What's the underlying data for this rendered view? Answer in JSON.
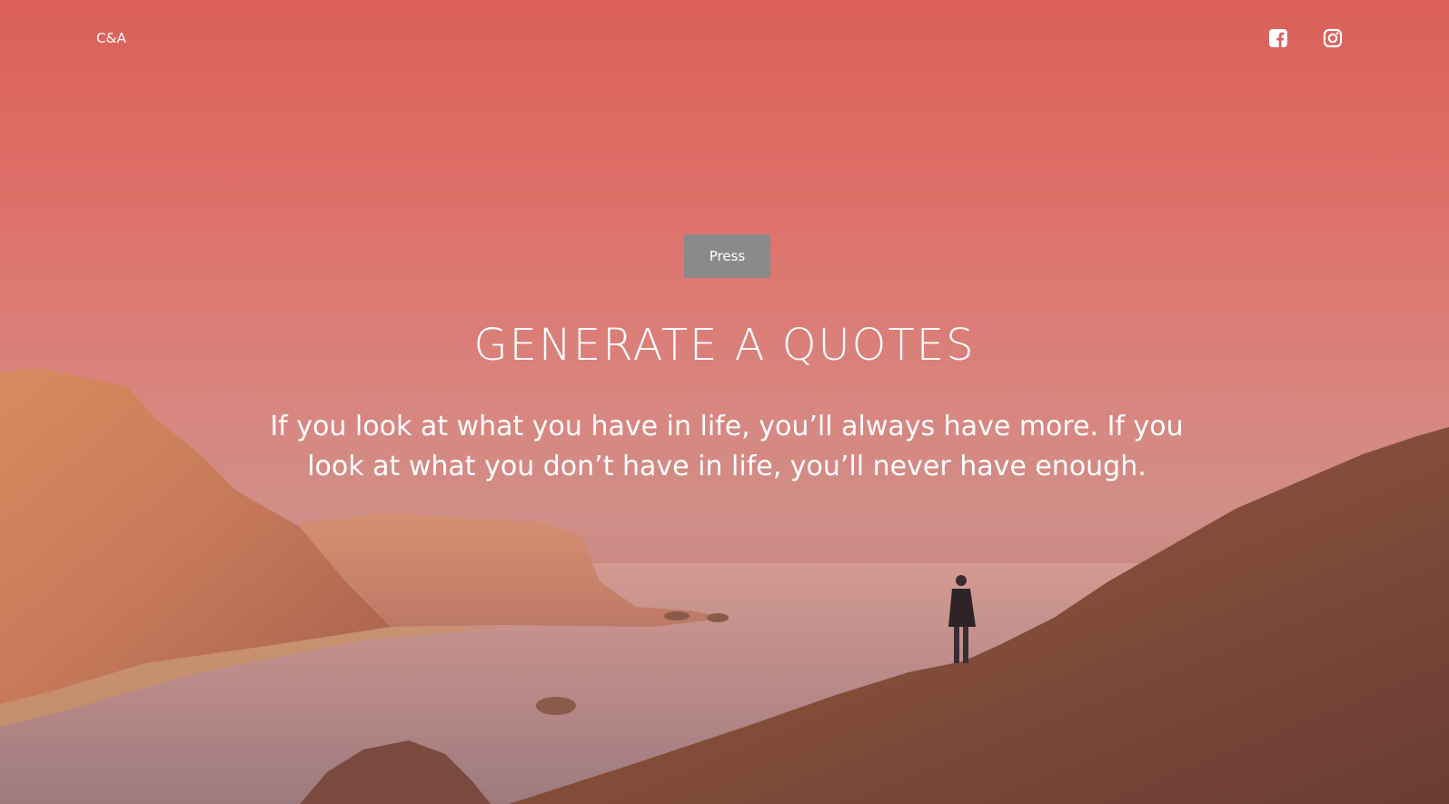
{
  "header": {
    "brand": "C&A",
    "social": [
      {
        "name": "facebook",
        "icon": "facebook-square-icon"
      },
      {
        "name": "instagram",
        "icon": "instagram-icon"
      }
    ]
  },
  "hero": {
    "button_label": "Press",
    "title": "GENERATE A QUOTES",
    "quote": "If you look at what you have in life, you’ll always have more. If you look at what you don’t have in life, you’ll never have enough."
  },
  "colors": {
    "sky_top": "#dc605a",
    "sky_mid": "#d9857f",
    "button_bg": "#8a8a8a",
    "text": "#ffffff"
  }
}
